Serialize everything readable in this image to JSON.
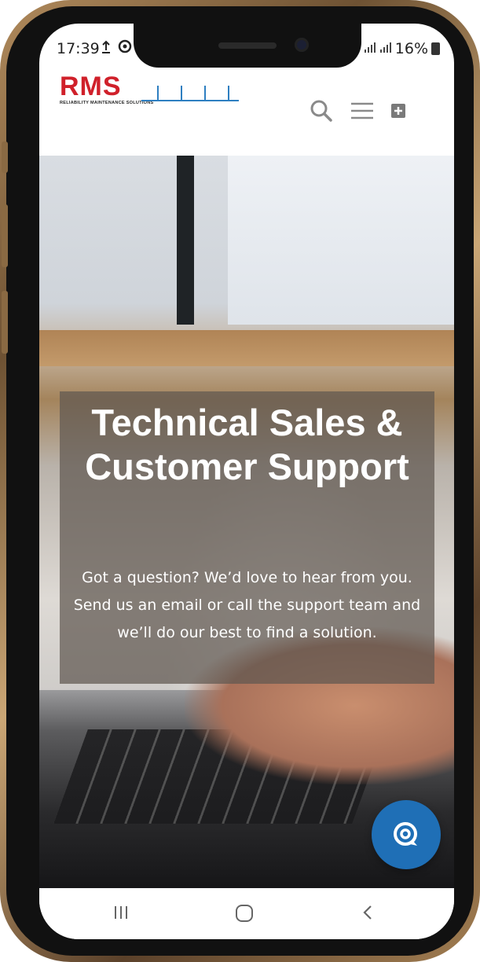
{
  "status_bar": {
    "time": "17:39",
    "battery": "16%",
    "left_icons": [
      "upload-icon",
      "app-notification-icon"
    ],
    "right_icons": [
      "signal-icon",
      "signal-icon",
      "battery-icon"
    ]
  },
  "header": {
    "logo_text": "RMS",
    "logo_tagline": "RELIABILITY MAINTENANCE SOLUTIONS",
    "icons": [
      "search-icon",
      "menu-icon",
      "plus-square-icon"
    ]
  },
  "hero": {
    "title": "Technical Sales & Customer Support",
    "text": "Got a question? We’d love to hear from you. Send us an email or call the support team and we’ll do our best to find a solution."
  },
  "chat_button": {
    "icon": "chat-icon"
  },
  "nav_bar": {
    "icons": [
      "recent-apps-icon",
      "home-icon",
      "back-icon"
    ]
  },
  "colors": {
    "logo_red": "#d0202a",
    "logo_blue": "#2e7fc1",
    "chat_button_blue": "#1f6fb6",
    "device_gold": "#b08a5c"
  }
}
